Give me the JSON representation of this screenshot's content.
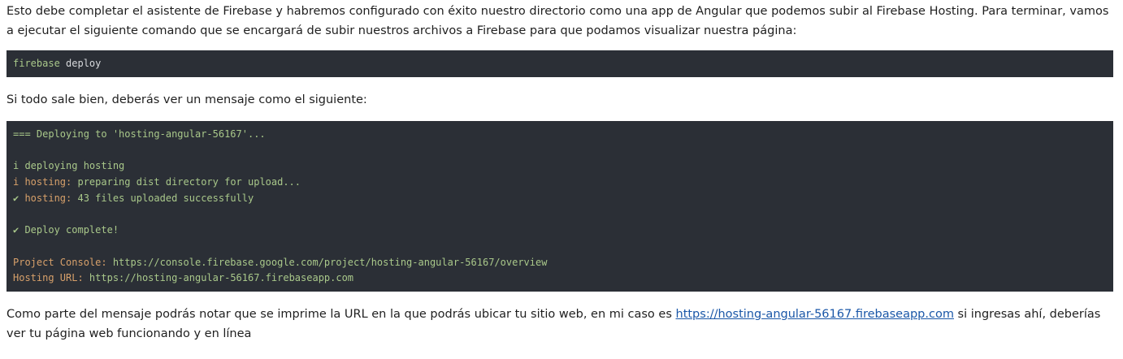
{
  "intro": {
    "text": "Esto debe completar el asistente de Firebase y habremos configurado con éxito nuestro directorio como una app de Angular que podemos subir al Firebase Hosting. Para terminar, vamos a ejecutar el siguiente comando que se encargará de subir nuestros archivos a Firebase para que podamos visualizar nuestra página:"
  },
  "command": {
    "program": "firebase",
    "argument": "deploy"
  },
  "result_intro": {
    "text": "Si todo sale bien, deberás ver un mensaje como el siguiente:"
  },
  "output": {
    "line1": "=== Deploying to 'hosting-angular-56167'...",
    "line2": "i deploying hosting",
    "line3_prefix": "i hosting:",
    "line3_rest": " preparing dist directory for upload...",
    "line4_check": "✔",
    "line4_prefix": " hosting:",
    "line4_rest": " 43 files uploaded successfully",
    "line5_check": "✔",
    "line5_rest": " Deploy complete!",
    "line6_label": "Project Console:",
    "line6_value": " https://console.firebase.google.com/project/hosting-angular-56167/overview",
    "line7_label": "Hosting URL:",
    "line7_value": " https://hosting-angular-56167.firebaseapp.com"
  },
  "closing": {
    "before_link": "Como parte del mensaje podrás notar que se imprime la URL en la que podrás ubicar tu sitio web, en mi caso es ",
    "link_text": "https://hosting-angular-56167.firebaseapp.com",
    "after_link": " si ingresas ahí, deberías ver tu página web funcionando y en línea"
  },
  "colors": {
    "code_background": "#2b2f36",
    "code_green": "#a9c88a",
    "code_orange": "#d7a06a",
    "link": "#1a57a8"
  }
}
